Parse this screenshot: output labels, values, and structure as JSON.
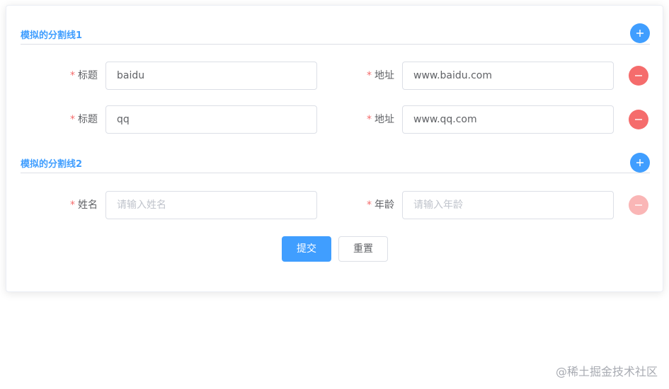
{
  "sections": [
    {
      "title": "模拟的分割线1",
      "rows": [
        {
          "field1": {
            "label": "标题",
            "value": "baidu",
            "placeholder": ""
          },
          "field2": {
            "label": "地址",
            "value": "www.baidu.com",
            "placeholder": ""
          }
        },
        {
          "field1": {
            "label": "标题",
            "value": "qq",
            "placeholder": ""
          },
          "field2": {
            "label": "地址",
            "value": "www.qq.com",
            "placeholder": ""
          }
        }
      ]
    },
    {
      "title": "模拟的分割线2",
      "rows": [
        {
          "field1": {
            "label": "姓名",
            "value": "",
            "placeholder": "请输入姓名"
          },
          "field2": {
            "label": "年龄",
            "value": "",
            "placeholder": "请输入年龄"
          }
        }
      ]
    }
  ],
  "required_mark": "*",
  "actions": {
    "submit": "提交",
    "reset": "重置"
  },
  "watermark": "@稀土掘金技术社区",
  "colors": {
    "primary": "#409eff",
    "danger": "#f56c6c",
    "danger_disabled": "#fab6b6",
    "border": "#dcdfe6",
    "text": "#606266",
    "placeholder": "#c0c4cc"
  },
  "icons": {
    "add": "plus-icon",
    "remove": "minus-icon"
  }
}
